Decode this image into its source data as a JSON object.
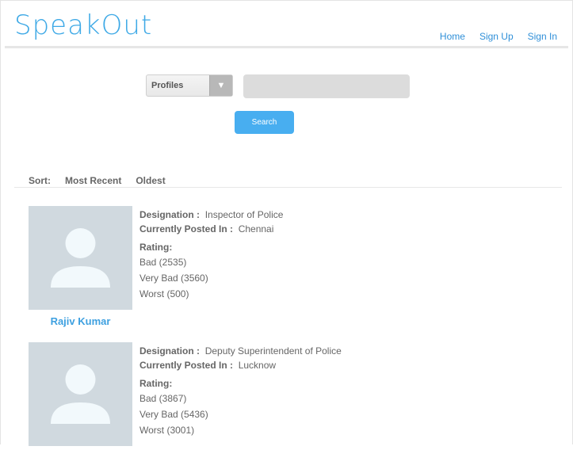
{
  "app": {
    "logo": "SpeakOut"
  },
  "nav": {
    "home": "Home",
    "signup": "Sign Up",
    "signin": "Sign In"
  },
  "search": {
    "category": "Profiles",
    "query": "",
    "button": "Search"
  },
  "sort": {
    "label": "Sort:",
    "recent": "Most Recent",
    "oldest": "Oldest"
  },
  "labels": {
    "designation": "Designation :",
    "posted": "Currently Posted In :",
    "rating": "Rating:"
  },
  "profiles": [
    {
      "name": "Rajiv Kumar",
      "designation": "Inspector of Police",
      "posted": "Chennai",
      "ratings": [
        "Bad (2535)",
        "Very Bad (3560)",
        "Worst (500)"
      ]
    },
    {
      "name": "",
      "designation": "Deputy Superintendent  of Police",
      "posted": "Lucknow",
      "ratings": [
        "Bad (3867)",
        "Very Bad (5436)",
        "Worst (3001)"
      ]
    }
  ],
  "colors": {
    "accent": "#3ea9e6",
    "button": "#48aef0",
    "avatar_bg": "#d0d9df"
  }
}
